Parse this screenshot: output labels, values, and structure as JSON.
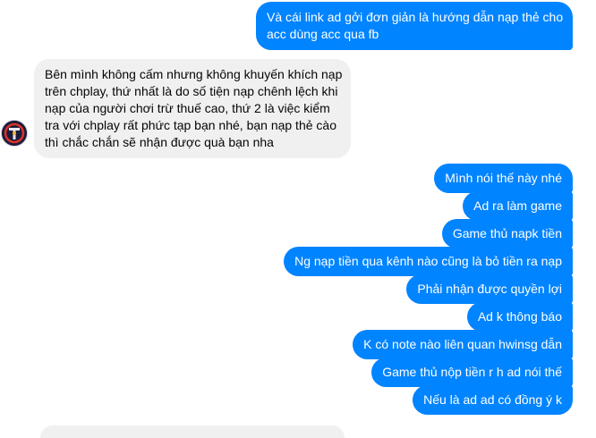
{
  "conversation": {
    "outgoing_top": {
      "lines": [
        "Và cái link ad gởi đơn giản là hướng dẫn nạp thẻ cho",
        "acc dùng acc qua fb"
      ]
    },
    "incoming": {
      "lines": [
        "Bên mình không cấm nhưng không khuyến khích nạp",
        "trên chplay, thứ nhất là do số tiện nạp chênh lệch khi",
        "nạp của người chơi trừ thuế cao, thứ 2 là việc kiểm",
        "tra với chplay rất phức tạp bạn nhé, bạn nạp thẻ cào",
        "thì chắc chắn sẽ nhận  được quà bạn nha"
      ],
      "avatar_icon": "game-logo-avatar-icon"
    },
    "outgoing": [
      "Mình nói thế này nhé",
      "Ad ra làm game",
      "Game thủ napk tiền",
      "Ng nạp tiền qua kênh nào cũng là bỏ tiền ra nạp",
      "Phải nhận được quyền lợi",
      "Ad k thông báo",
      "K có note nào liên quan hwinsg dẫn",
      "Game thủ nộp tiền r h ad nói thế",
      "Nếu là ad ad có đồng ý k"
    ]
  },
  "colors": {
    "outgoing_bubble": "#0084ff",
    "incoming_bubble": "#f0f0f0",
    "text_dark": "#050505"
  }
}
